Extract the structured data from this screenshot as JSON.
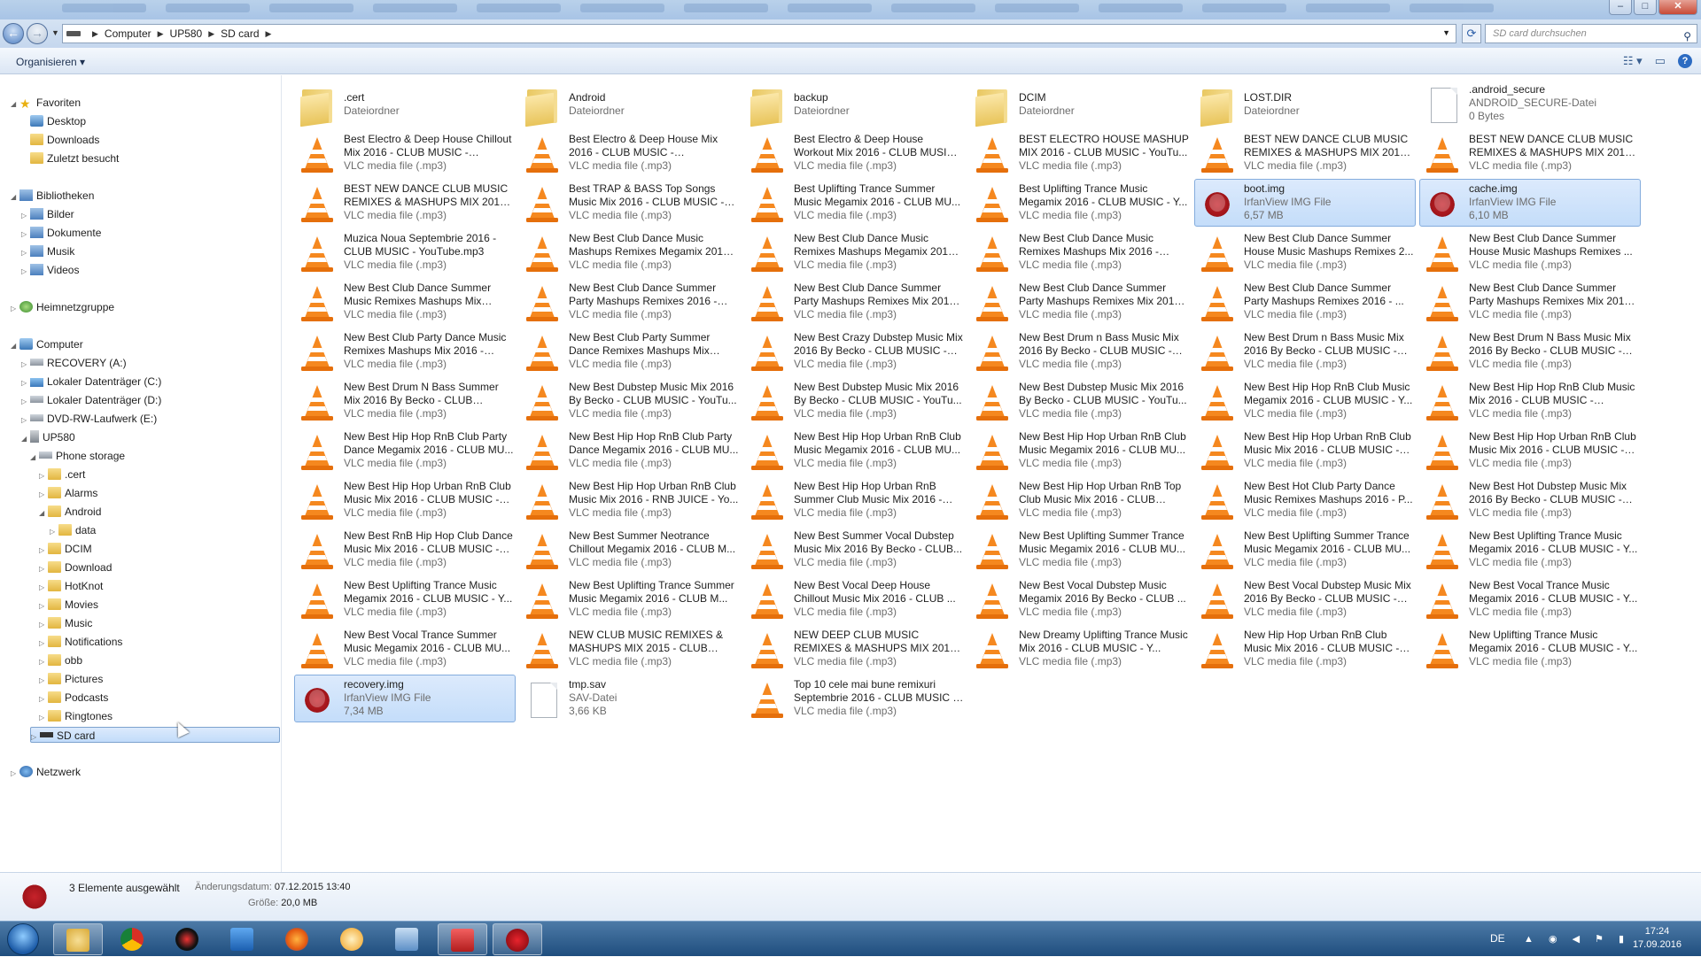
{
  "window": {
    "controls": {
      "minimize": "–",
      "maximize": "□",
      "close": "✕"
    }
  },
  "address_bar": {
    "crumbs": [
      "Computer",
      "UP580",
      "SD card"
    ],
    "search_placeholder": "SD card durchsuchen"
  },
  "command_bar": {
    "organize_label": "Organisieren"
  },
  "nav_pane": {
    "items": [
      {
        "label": "Favoriten",
        "icon": "star-icon",
        "level": 0,
        "expand": "open"
      },
      {
        "label": "Desktop",
        "icon": "desktop-icon",
        "level": 1
      },
      {
        "label": "Downloads",
        "icon": "downloads-icon",
        "level": 1
      },
      {
        "label": "Zuletzt besucht",
        "icon": "recent-places-icon",
        "level": 1
      },
      {
        "label": "Bibliotheken",
        "icon": "libraries-icon",
        "level": 0,
        "expand": "open"
      },
      {
        "label": "Bilder",
        "icon": "pictures-library-icon",
        "level": 1,
        "expand": "closed"
      },
      {
        "label": "Dokumente",
        "icon": "documents-library-icon",
        "level": 1,
        "expand": "closed"
      },
      {
        "label": "Musik",
        "icon": "music-library-icon",
        "level": 1,
        "expand": "closed"
      },
      {
        "label": "Videos",
        "icon": "videos-library-icon",
        "level": 1,
        "expand": "closed"
      },
      {
        "label": "Heimnetzgruppe",
        "icon": "homegroup-icon",
        "level": 0,
        "expand": "closed"
      },
      {
        "label": "Computer",
        "icon": "computer-icon",
        "level": 0,
        "expand": "open"
      },
      {
        "label": "RECOVERY (A:)",
        "icon": "drive-icon",
        "level": 1,
        "expand": "closed"
      },
      {
        "label": "Lokaler Datenträger (C:)",
        "icon": "windows-drive-icon",
        "level": 1,
        "expand": "closed"
      },
      {
        "label": "Lokaler Datenträger (D:)",
        "icon": "drive-icon",
        "level": 1,
        "expand": "closed"
      },
      {
        "label": "DVD-RW-Laufwerk (E:)",
        "icon": "dvd-drive-icon",
        "level": 1,
        "expand": "closed"
      },
      {
        "label": "UP580",
        "icon": "phone-icon",
        "level": 1,
        "expand": "open"
      },
      {
        "label": "Phone storage",
        "icon": "storage-icon",
        "level": 2,
        "expand": "open"
      },
      {
        "label": ".cert",
        "icon": "folder-icon",
        "level": 3,
        "expand": "closed"
      },
      {
        "label": "Alarms",
        "icon": "folder-icon",
        "level": 3,
        "expand": "closed"
      },
      {
        "label": "Android",
        "icon": "folder-icon",
        "level": 3,
        "expand": "open"
      },
      {
        "label": "data",
        "icon": "folder-icon",
        "level": 4,
        "expand": "closed"
      },
      {
        "label": "DCIM",
        "icon": "folder-icon",
        "level": 3,
        "expand": "closed"
      },
      {
        "label": "Download",
        "icon": "folder-icon",
        "level": 3,
        "expand": "closed"
      },
      {
        "label": "HotKnot",
        "icon": "folder-icon",
        "level": 3,
        "expand": "closed"
      },
      {
        "label": "Movies",
        "icon": "folder-icon",
        "level": 3,
        "expand": "closed"
      },
      {
        "label": "Music",
        "icon": "folder-icon",
        "level": 3,
        "expand": "closed"
      },
      {
        "label": "Notifications",
        "icon": "folder-icon",
        "level": 3,
        "expand": "closed"
      },
      {
        "label": "obb",
        "icon": "folder-icon",
        "level": 3,
        "expand": "closed"
      },
      {
        "label": "Pictures",
        "icon": "folder-icon",
        "level": 3,
        "expand": "closed"
      },
      {
        "label": "Podcasts",
        "icon": "folder-icon",
        "level": 3,
        "expand": "closed"
      },
      {
        "label": "Ringtones",
        "icon": "folder-icon",
        "level": 3,
        "expand": "closed"
      },
      {
        "label": "SD card",
        "icon": "sd-card-icon",
        "level": 2,
        "expand": "closed",
        "selected": true
      },
      {
        "label": "Netzwerk",
        "icon": "network-icon",
        "level": 0,
        "expand": "closed"
      }
    ]
  },
  "files": [
    {
      "name": ".cert",
      "type": "Dateiordner",
      "icon": "folder"
    },
    {
      "name": "Android",
      "type": "Dateiordner",
      "icon": "folder"
    },
    {
      "name": "backup",
      "type": "Dateiordner",
      "icon": "folder"
    },
    {
      "name": "DCIM",
      "type": "Dateiordner",
      "icon": "folder"
    },
    {
      "name": "LOST.DIR",
      "type": "Dateiordner",
      "icon": "folder"
    },
    {
      "name": ".android_secure",
      "type": "ANDROID_SECURE-Datei",
      "size": "0 Bytes",
      "icon": "file"
    },
    {
      "name": "Best Electro & Deep House Chillout Mix 2016 - CLUB MUSIC - YouTub...",
      "type": "VLC media file (.mp3)",
      "icon": "vlc"
    },
    {
      "name": "Best Electro & Deep House Mix 2016 - CLUB MUSIC - YouTube.m...",
      "type": "VLC media file (.mp3)",
      "icon": "vlc"
    },
    {
      "name": "Best Electro & Deep House Workout Mix 2016 - CLUB MUSIC ...",
      "type": "VLC media file (.mp3)",
      "icon": "vlc"
    },
    {
      "name": "BEST ELECTRO HOUSE MASHUP MIX 2016 - CLUB MUSIC - YouTu...",
      "type": "VLC media file (.mp3)",
      "icon": "vlc"
    },
    {
      "name": "BEST NEW DANCE CLUB MUSIC REMIXES & MASHUPS MIX 2015 - ...",
      "type": "VLC media file (.mp3)",
      "icon": "vlc"
    },
    {
      "name": "BEST NEW DANCE CLUB MUSIC REMIXES & MASHUPS MIX 2015 - ...",
      "type": "VLC media file (.mp3)",
      "icon": "vlc"
    },
    {
      "name": "BEST NEW DANCE CLUB MUSIC REMIXES & MASHUPS MIX 2015 - ...",
      "type": "VLC media file (.mp3)",
      "icon": "vlc"
    },
    {
      "name": "Best TRAP & BASS Top Songs Music Mix 2016 - CLUB MUSIC - Y...",
      "type": "VLC media file (.mp3)",
      "icon": "vlc"
    },
    {
      "name": "Best Uplifting Trance  Summer Music Megamix 2016 - CLUB MU...",
      "type": "VLC media file (.mp3)",
      "icon": "vlc"
    },
    {
      "name": "Best Uplifting Trance Music Megamix 2016 - CLUB MUSIC - Y...",
      "type": "VLC media file (.mp3)",
      "icon": "vlc"
    },
    {
      "name": "boot.img",
      "type": "IrfanView IMG File",
      "size": "6,57 MB",
      "icon": "irfan",
      "selected": true
    },
    {
      "name": "cache.img",
      "type": "IrfanView IMG File",
      "size": "6,10 MB",
      "icon": "irfan",
      "selected": true
    },
    {
      "name": "Muzica Noua Septembrie 2016 - CLUB MUSIC - YouTube.mp3",
      "type": "VLC media file (.mp3)",
      "icon": "vlc"
    },
    {
      "name": "New Best Club Dance Music Mashups Remixes Megamix 2016 ...",
      "type": "VLC media file (.mp3)",
      "icon": "vlc"
    },
    {
      "name": "New Best Club Dance Music Remixes Mashups Megamix 2016 ...",
      "type": "VLC media file (.mp3)",
      "icon": "vlc"
    },
    {
      "name": "New Best Club Dance Music Remixes Mashups Mix 2016 - CLU...",
      "type": "VLC media file (.mp3)",
      "icon": "vlc"
    },
    {
      "name": "New Best Club Dance Summer House Music Mashups Remixes 2...",
      "type": "VLC media file (.mp3)",
      "icon": "vlc"
    },
    {
      "name": "New Best Club Dance Summer House Music Mashups Remixes ...",
      "type": "VLC media file (.mp3)",
      "icon": "vlc"
    },
    {
      "name": "New Best Club Dance Summer Music Remixes Mashups Mix 2016...",
      "type": "VLC media file (.mp3)",
      "icon": "vlc"
    },
    {
      "name": "New Best Club Dance Summer Party Mashups Remixes 2016 - CL...",
      "type": "VLC media file (.mp3)",
      "icon": "vlc"
    },
    {
      "name": "New Best Club Dance Summer Party Mashups Remixes Mix 2016 ...",
      "type": "VLC media file (.mp3)",
      "icon": "vlc"
    },
    {
      "name": "New Best Club Dance Summer Party Mashups Remixes Mix 2016 ...",
      "type": "VLC media file (.mp3)",
      "icon": "vlc"
    },
    {
      "name": "New Best Club Dance Summer Party Mashups Remixes 2016 - ...",
      "type": "VLC media file (.mp3)",
      "icon": "vlc"
    },
    {
      "name": "New Best Club Dance Summer Party Mashups Remixes Mix 2016 ...",
      "type": "VLC media file (.mp3)",
      "icon": "vlc"
    },
    {
      "name": "New Best Club Party Dance Music Remixes Mashups Mix 2016 - PDB...",
      "type": "VLC media file (.mp3)",
      "icon": "vlc"
    },
    {
      "name": "New Best Club Party Summer Dance Remixes Mashups Mix 201...",
      "type": "VLC media file (.mp3)",
      "icon": "vlc"
    },
    {
      "name": "New Best Crazy Dubstep Music Mix 2016  By Becko - CLUB MUSIC - Y...",
      "type": "VLC media file (.mp3)",
      "icon": "vlc"
    },
    {
      "name": "New Best Drum n Bass Music Mix 2016  By Becko - CLUB MUSIC - Y...",
      "type": "VLC media file (.mp3)",
      "icon": "vlc"
    },
    {
      "name": "New Best Drum n Bass Music Mix 2016  By Becko - CLUB MUSIC - Y...",
      "type": "VLC media file (.mp3)",
      "icon": "vlc"
    },
    {
      "name": "New Best Drum N Bass Music Mix 2016 By Becko - CLUB MUSIC - Y...",
      "type": "VLC media file (.mp3)",
      "icon": "vlc"
    },
    {
      "name": "New Best Drum N Bass Summer Mix 2016 By Becko - CLUB MUSIC...",
      "type": "VLC media file (.mp3)",
      "icon": "vlc"
    },
    {
      "name": "New Best Dubstep Music Mix 2016 By Becko - CLUB MUSIC - YouTu...",
      "type": "VLC media file (.mp3)",
      "icon": "vlc"
    },
    {
      "name": "New Best Dubstep Music Mix 2016 By Becko - CLUB MUSIC - YouTu...",
      "type": "VLC media file (.mp3)",
      "icon": "vlc"
    },
    {
      "name": "New Best Dubstep Music Mix 2016 By Becko - CLUB MUSIC - YouTu...",
      "type": "VLC media file (.mp3)",
      "icon": "vlc"
    },
    {
      "name": "New Best Hip Hop RnB Club Music Megamix 2016 - CLUB MUSIC - Y...",
      "type": "VLC media file (.mp3)",
      "icon": "vlc"
    },
    {
      "name": "New Best Hip Hop RnB Club Music Mix 2016 - CLUB MUSIC - YouTub...",
      "type": "VLC media file (.mp3)",
      "icon": "vlc"
    },
    {
      "name": "New Best Hip Hop RnB Club Party Dance Megamix 2016 - CLUB MU...",
      "type": "VLC media file (.mp3)",
      "icon": "vlc"
    },
    {
      "name": "New Best Hip Hop RnB Club Party Dance Megamix 2016 - CLUB MU...",
      "type": "VLC media file (.mp3)",
      "icon": "vlc"
    },
    {
      "name": "New Best Hip Hop Urban RnB Club Music Megamix 2016 - CLUB MU...",
      "type": "VLC media file (.mp3)",
      "icon": "vlc"
    },
    {
      "name": "New Best Hip Hop Urban RnB Club Music Megamix 2016 - CLUB MU...",
      "type": "VLC media file (.mp3)",
      "icon": "vlc"
    },
    {
      "name": "New Best Hip Hop Urban RnB Club Music Mix 2016 - CLUB MUSIC - Y...",
      "type": "VLC media file (.mp3)",
      "icon": "vlc"
    },
    {
      "name": "New Best Hip Hop Urban RnB Club Music Mix 2016 - CLUB MUSIC - Y...",
      "type": "VLC media file (.mp3)",
      "icon": "vlc"
    },
    {
      "name": "New Best Hip Hop Urban RnB Club Music Mix 2016 - CLUB MUSIC - Y...",
      "type": "VLC media file (.mp3)",
      "icon": "vlc"
    },
    {
      "name": "New Best Hip Hop Urban RnB Club Music Mix 2016 - RNB JUICE - Yo...",
      "type": "VLC media file (.mp3)",
      "icon": "vlc"
    },
    {
      "name": "New Best Hip Hop Urban RnB Summer Club Music Mix 2016 - CLUB M...",
      "type": "VLC media file (.mp3)",
      "icon": "vlc"
    },
    {
      "name": "New Best Hip Hop Urban RnB Top Club Music Mix 2016 - CLUB MUS...",
      "type": "VLC media file (.mp3)",
      "icon": "vlc"
    },
    {
      "name": "New Best Hot Club Party Dance Music Remixes Mashups 2016 - P...",
      "type": "VLC media file (.mp3)",
      "icon": "vlc"
    },
    {
      "name": "New Best Hot Dubstep Music Mix 2016 By Becko - CLUB MUSIC - Y...",
      "type": "VLC media file (.mp3)",
      "icon": "vlc"
    },
    {
      "name": "New Best RnB Hip Hop Club Dance Music Mix 2016 - CLUB MUSIC - Y...",
      "type": "VLC media file (.mp3)",
      "icon": "vlc"
    },
    {
      "name": "New Best Summer Neotrance Chillout Megamix 2016 - CLUB M...",
      "type": "VLC media file (.mp3)",
      "icon": "vlc"
    },
    {
      "name": "New Best Summer Vocal Dubstep Music Mix 2016   By Becko - CLUB...",
      "type": "VLC media file (.mp3)",
      "icon": "vlc"
    },
    {
      "name": "New Best Uplifting Summer Trance Music Megamix 2016 - CLUB MU...",
      "type": "VLC media file (.mp3)",
      "icon": "vlc"
    },
    {
      "name": "New Best Uplifting Summer Trance Music Megamix 2016 - CLUB MU...",
      "type": "VLC media file (.mp3)",
      "icon": "vlc"
    },
    {
      "name": "New Best Uplifting Trance Music Megamix 2016 - CLUB MUSIC - Y...",
      "type": "VLC media file (.mp3)",
      "icon": "vlc"
    },
    {
      "name": "New Best Uplifting Trance Music Megamix 2016 - CLUB MUSIC - Y...",
      "type": "VLC media file (.mp3)",
      "icon": "vlc"
    },
    {
      "name": "New Best Uplifting Trance Summer Music Megamix 2016 - CLUB M...",
      "type": "VLC media file (.mp3)",
      "icon": "vlc"
    },
    {
      "name": "New Best Vocal Deep House Chillout Music Mix 2016 - CLUB ...",
      "type": "VLC media file (.mp3)",
      "icon": "vlc"
    },
    {
      "name": "New Best Vocal Dubstep Music Megamix 2016 By Becko - CLUB ...",
      "type": "VLC media file (.mp3)",
      "icon": "vlc"
    },
    {
      "name": "New Best Vocal Dubstep Music Mix 2016  By Becko - CLUB MUSIC - Y...",
      "type": "VLC media file (.mp3)",
      "icon": "vlc"
    },
    {
      "name": "New Best Vocal Trance Music Megamix 2016 - CLUB MUSIC - Y...",
      "type": "VLC media file (.mp3)",
      "icon": "vlc"
    },
    {
      "name": "New Best Vocal Trance Summer Music Megamix 2016 - CLUB MU...",
      "type": "VLC media file (.mp3)",
      "icon": "vlc"
    },
    {
      "name": "NEW CLUB MUSIC REMIXES & MASHUPS MIX 2015 - CLUB MUSI...",
      "type": "VLC media file (.mp3)",
      "icon": "vlc"
    },
    {
      "name": "NEW DEEP CLUB MUSIC REMIXES & MASHUPS MIX 2015 - CLUB M...",
      "type": "VLC media file (.mp3)",
      "icon": "vlc"
    },
    {
      "name": "New Dreamy Uplifting Trance Music Mix 2016 - CLUB MUSIC - Y...",
      "type": "VLC media file (.mp3)",
      "icon": "vlc"
    },
    {
      "name": "New Hip Hop Urban RnB Club Music Mix 2016 - CLUB MUSIC - Y...",
      "type": "VLC media file (.mp3)",
      "icon": "vlc"
    },
    {
      "name": "New Uplifting Trance Music Megamix 2016 - CLUB MUSIC - Y...",
      "type": "VLC media file (.mp3)",
      "icon": "vlc"
    },
    {
      "name": "recovery.img",
      "type": "IrfanView IMG File",
      "size": "7,34 MB",
      "icon": "irfan",
      "selected": true
    },
    {
      "name": "tmp.sav",
      "type": "SAV-Datei",
      "size": "3,66 KB",
      "icon": "file"
    },
    {
      "name": "Top 10 cele mai bune remixuri Septembrie 2016 - CLUB MUSIC - ...",
      "type": "VLC media file (.mp3)",
      "icon": "vlc"
    }
  ],
  "details": {
    "selection": "3 Elemente ausgewählt",
    "modified_label": "Änderungsdatum:",
    "modified_value": "07.12.2015 13:40",
    "size_label": "Größe:",
    "size_value": "20,0 MB"
  },
  "taskbar": {
    "apps": [
      "explorer-icon",
      "chrome-icon",
      "app-2017-icon",
      "download-manager-icon",
      "firefox-icon",
      "settings-gear-icon",
      "remote-desktop-icon",
      "toolbox-icon",
      "irfanview-icon"
    ],
    "lang": "DE",
    "time": "17:24",
    "date": "17.09.2016"
  }
}
